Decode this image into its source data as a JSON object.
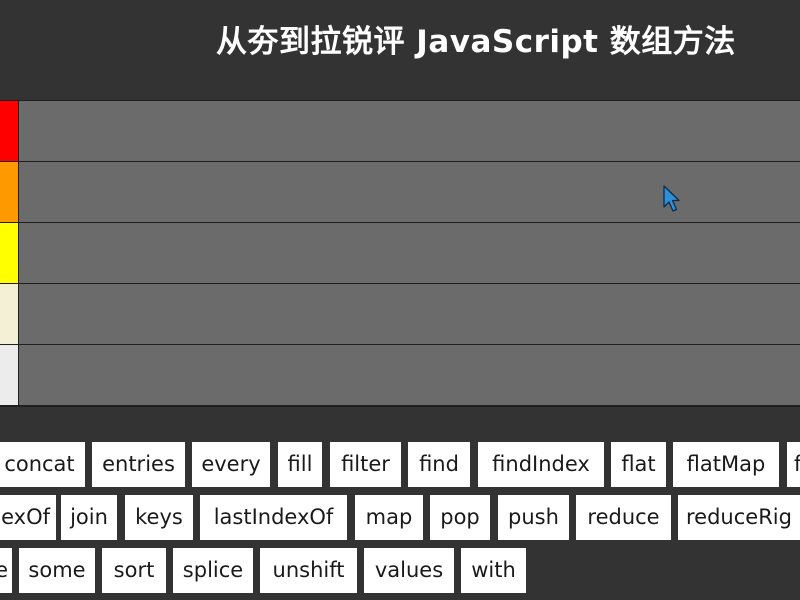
{
  "title": "从夯到拉锐评 JavaScript 数组方法",
  "tiers": [
    {
      "color": "#ff0000"
    },
    {
      "color": "#ff9900"
    },
    {
      "color": "#ffff00"
    },
    {
      "color": "#f3f0d6"
    },
    {
      "color": "#ececec"
    }
  ],
  "method_rows": [
    [
      "concat",
      "entries",
      "every",
      "fill",
      "filter",
      "find",
      "findIndex",
      "flat",
      "flatMap",
      "f"
    ],
    [
      "exOf",
      "join",
      "keys",
      "lastIndexOf",
      "map",
      "pop",
      "push",
      "reduce",
      "reduceRig"
    ],
    [
      "e",
      "some",
      "sort",
      "splice",
      "unshift",
      "values",
      "with"
    ]
  ],
  "cursor_icon": "mouse-pointer-icon"
}
